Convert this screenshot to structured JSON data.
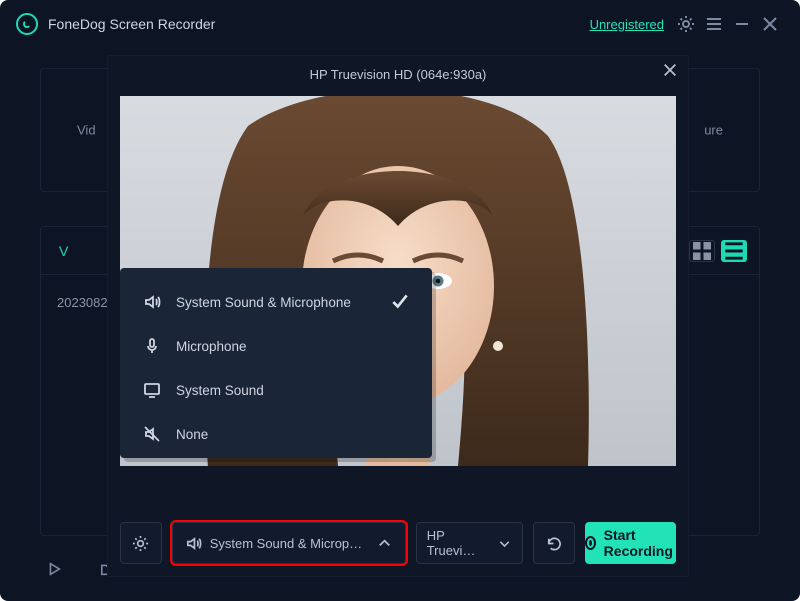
{
  "brand": "FoneDog Screen Recorder",
  "header": {
    "unregistered": "Unregistered"
  },
  "bg": {
    "video_label_left": "Vid",
    "video_label_right": "ure",
    "video_tab": "V",
    "file_row": "2023082"
  },
  "overlay": {
    "title": "HP Truevision HD (064e:930a)"
  },
  "audio_menu": {
    "items": [
      {
        "label": "System Sound & Microphone",
        "icon": "speaker",
        "checked": true
      },
      {
        "label": "Microphone",
        "icon": "mic",
        "checked": false
      },
      {
        "label": "System Sound",
        "icon": "pc",
        "checked": false
      },
      {
        "label": "None",
        "icon": "mute",
        "checked": false
      }
    ]
  },
  "controls": {
    "audio_selected": "System Sound & Microphone",
    "camera_selected": "HP Truevi…",
    "start": "Start Recording"
  }
}
